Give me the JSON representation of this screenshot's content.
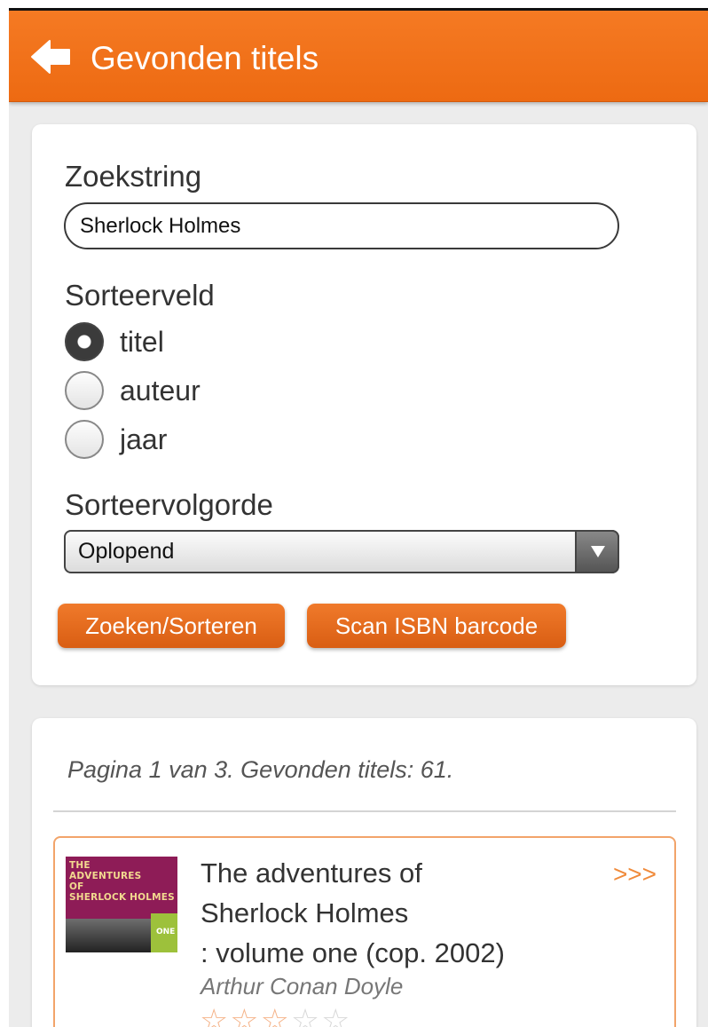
{
  "header": {
    "title": "Gevonden titels"
  },
  "search": {
    "query_label": "Zoekstring",
    "query_value": "Sherlock Holmes",
    "sort_field_label": "Sorteerveld",
    "sort_options": [
      {
        "label": "titel",
        "selected": true
      },
      {
        "label": "auteur",
        "selected": false
      },
      {
        "label": "jaar",
        "selected": false
      }
    ],
    "sort_order_label": "Sorteervolgorde",
    "sort_order_value": "Oplopend",
    "search_button": "Zoeken/Sorteren",
    "scan_button": "Scan ISBN barcode"
  },
  "results": {
    "info": "Pagina 1 van 3. Gevonden titels: 61.",
    "items": [
      {
        "title_line1": "The adventures of",
        "title_line2": "Sherlock Holmes",
        "title_line3": ": volume one (cop. 2002)",
        "author": "Arthur Conan Doyle",
        "more": ">>>",
        "rating": 3,
        "rating_max": 5,
        "cover": {
          "lines": [
            "THE",
            "ADVENTURES",
            "OF",
            "SHERLOCK HOLMES"
          ],
          "tag": "ONE"
        }
      }
    ]
  },
  "colors": {
    "accent": "#f57a23",
    "button": "#e0671a",
    "background": "#ececec",
    "item_border": "#f2a46a"
  }
}
